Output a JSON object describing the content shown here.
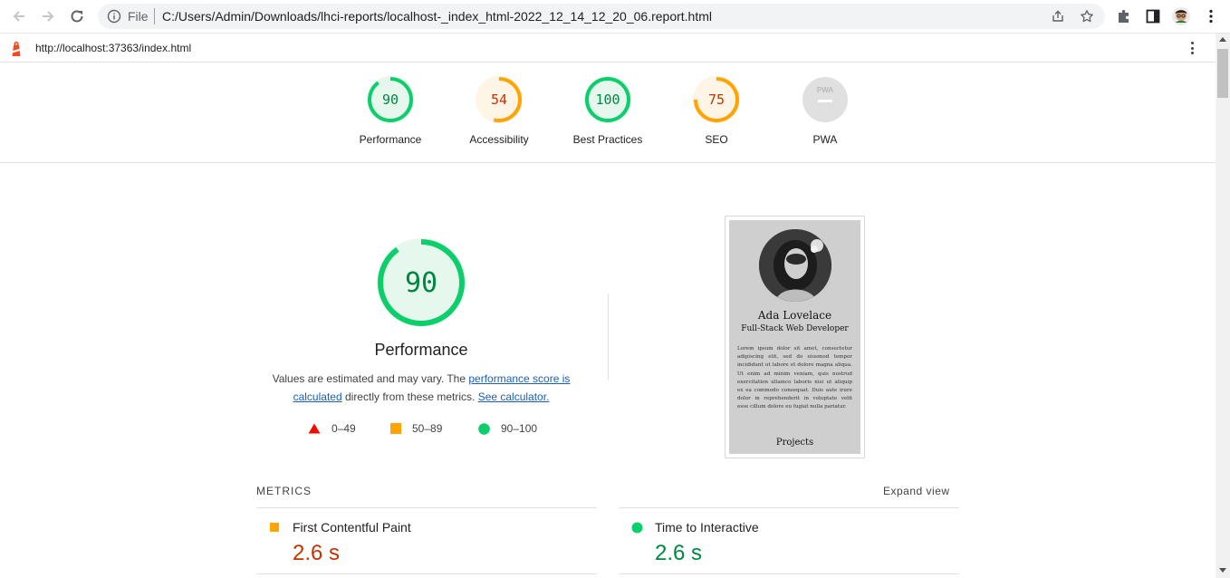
{
  "browser": {
    "scheme_label": "File",
    "address": "C:/Users/Admin/Downloads/lhci-reports/localhost-_index_html-2022_12_14_12_20_06.report.html"
  },
  "lighthouse": {
    "url": "http://localhost:37363/index.html"
  },
  "categories": [
    {
      "label": "Performance",
      "score": "90",
      "fraction": 0.9,
      "color": "#0cce6b"
    },
    {
      "label": "Accessibility",
      "score": "54",
      "fraction": 0.54,
      "color": "#ffa400"
    },
    {
      "label": "Best Practices",
      "score": "100",
      "fraction": 1.0,
      "color": "#0cce6b"
    },
    {
      "label": "SEO",
      "score": "75",
      "fraction": 0.75,
      "color": "#ffa400"
    },
    {
      "label": "PWA",
      "badge": "PWA"
    }
  ],
  "performance": {
    "score": "90",
    "fraction": 0.9,
    "title": "Performance",
    "desc_prefix": "Values are estimated and may vary. The ",
    "desc_link1": "performance score is calculated",
    "desc_middle": " directly from these metrics. ",
    "desc_link2": "See calculator.",
    "legend": [
      {
        "range": "0–49",
        "shape": "triangle",
        "color": "#eb0f00"
      },
      {
        "range": "50–89",
        "shape": "square",
        "color": "#ffa400"
      },
      {
        "range": "90–100",
        "shape": "circle",
        "color": "#0cce6b"
      }
    ]
  },
  "thumbnail": {
    "name": "Ada Lovelace",
    "role": "Full-Stack Web Developer",
    "text": "Lorem ipsum dolor sit amet, consectetur adipiscing elit, sed do eiusmod tempor incididunt ut labore et dolore magna aliqua. Ut enim ad minim veniam, quis nostrud exercitation ullamco laboris nisi ut aliquip ex ea commodo consequat. Duis aute irure dolor in reprehenderit in voluptate velit esse cillum dolore eu fugiat nulla pariatur.",
    "footer": "Projects"
  },
  "metrics": {
    "title": "METRICS",
    "expand_label": "Expand view",
    "items": [
      {
        "title": "First Contentful Paint",
        "value": "2.6 s",
        "rating": "average",
        "color": "#c33300",
        "icon_color": "#ffa400"
      },
      {
        "title": "Time to Interactive",
        "value": "2.6 s",
        "rating": "pass",
        "color": "#018642",
        "icon_color": "#0cce6b"
      }
    ]
  }
}
